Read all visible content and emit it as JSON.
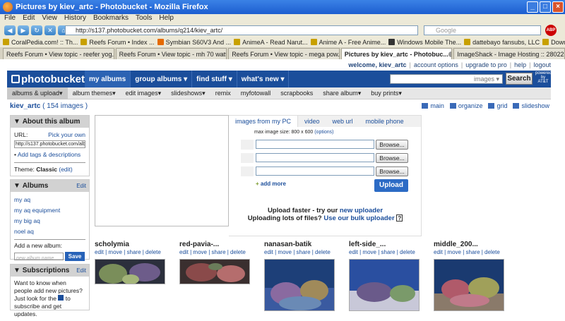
{
  "window": {
    "title": "Pictures by kiev_artc - Photobucket - Mozilla Firefox"
  },
  "menu": [
    "File",
    "Edit",
    "View",
    "History",
    "Bookmarks",
    "Tools",
    "Help"
  ],
  "url": "http://s137.photobucket.com/albums/q214/kiev_artc/",
  "search_placeholder": "Google",
  "bookmarks": [
    "CoralPedia.com! :: Th...",
    "Reefs Forum • Index ...",
    "Symbian S60V3 And ...",
    "AnimeA - Read Narut...",
    "Anime A - Free Anime...",
    "Windows Mobile The...",
    "dattebayo fansubs, LLC",
    "Downloads | Naruto E..."
  ],
  "tabs": [
    "Reefs Forum • View topic - reefer yog...",
    "Reefs Forum • View topic - mh 70 watt",
    "Reefs Forum • View topic - mega pow...",
    "Pictures by kiev_artc - Photobuc...",
    "ImageShack - Image Hosting :: 28022..."
  ],
  "toplinks": [
    "welcome, kiev_artc",
    "account options",
    "upgrade to pro",
    "help",
    "logout"
  ],
  "brand": "photobucket",
  "mainnav": [
    "my albums",
    "group albums ▾",
    "find stuff ▾",
    "what's new ▾"
  ],
  "site_search": {
    "scope": "images ▾",
    "button": "Search"
  },
  "sponsor": "powered by AT&T",
  "subnav": [
    "albums & upload▾",
    "album themes▾",
    "edit images▾",
    "slideshows▾",
    "remix",
    "myfotowall",
    "scrapbooks",
    "share album▾",
    "buy prints▾"
  ],
  "album": {
    "name": "kiev_artc",
    "count": "( 154 images )"
  },
  "views": [
    "main",
    "organize",
    "grid",
    "slideshow"
  ],
  "about": {
    "title": "About this album",
    "url_label": "URL:",
    "pick_label": "Pick your own",
    "url": "http://s137.photobucket.com/albu",
    "tags_link": "Add tags & descriptions",
    "theme_label": "Theme:",
    "theme": "Classic",
    "theme_edit": "(edit)"
  },
  "albums": {
    "title": "Albums",
    "edit": "Edit",
    "items": [
      "my aq",
      "my aq equipment",
      "my big aq",
      "noel aq"
    ],
    "add_label": "Add a new album:",
    "placeholder": "new album name",
    "save": "Save"
  },
  "subs": {
    "title": "Subscriptions",
    "edit": "Edit",
    "text1": "Want to know when people add new pictures? Just look for the",
    "text2": "to subscribe and get updates."
  },
  "upload": {
    "tabs": [
      "images from my PC",
      "video",
      "web url",
      "mobile phone"
    ],
    "max_prefix": "max image size: 800 x 600",
    "max_link": "(options)",
    "browse": "Browse...",
    "add_more": "add more",
    "button": "Upload",
    "faster_a": "Upload faster - try our",
    "faster_link": "new uploader",
    "bulk_a": "Uploading lots of files?",
    "bulk_link": "Use our bulk uploader",
    "qm": "?"
  },
  "thumbs": [
    {
      "title": "scholymia"
    },
    {
      "title": "red-pavia-..."
    },
    {
      "title": "nanasan-batik"
    },
    {
      "title": "left-side_..."
    },
    {
      "title": "middle_200..."
    }
  ],
  "thumb_actions": "edit | move | share | delete"
}
